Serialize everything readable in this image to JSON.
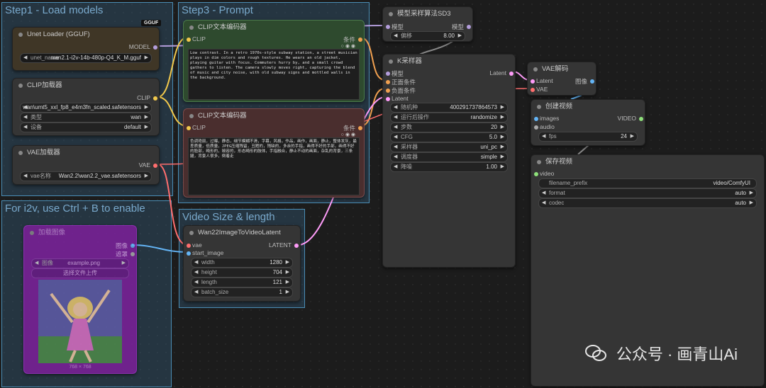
{
  "groups": {
    "step1": "Step1 - Load models",
    "step3": "Step3 - Prompt",
    "i2v": "For i2v, use Ctrl + B to enable",
    "video_size": "Video Size & length"
  },
  "unet_loader": {
    "title": "Unet Loader (GGUF)",
    "badge": "GGUF",
    "output": "MODEL",
    "widget_label": "unet_name",
    "widget_value": "wan2.1-i2v-14b-480p-Q4_K_M.gguf"
  },
  "clip_loader": {
    "title": "CLIP加载器",
    "output": "CLIP",
    "w1_label": "",
    "w1_value": "wan\\umt5_xxl_fp8_e4m3fn_scaled.safetensors",
    "w2_label": "类型",
    "w2_value": "wan",
    "w3_label": "设备",
    "w3_value": "default"
  },
  "vae_loader": {
    "title": "VAE加载器",
    "output": "VAE",
    "widget_label": "vae名称",
    "widget_value": "Wan2.2\\wan2.2_vae.safetensors"
  },
  "load_image": {
    "title": "加载图像",
    "out1": "图像",
    "out2": "遮罩",
    "widget_label": "图像",
    "widget_value": "example.png",
    "upload_label": "选择文件上传",
    "caption": "768 × 768"
  },
  "clip_pos": {
    "title": "CLIP文本编码器",
    "input": "CLIP",
    "output": "条件",
    "text": "Low contrast. In a retro 1970s-style subway station, a street musician plays in dim colors and rough textures. He wears an old jacket, playing guitar with focus. Commuters hurry by, and a small crowd gathers to listen. The camera slowly moves right, capturing the blend of music and city noise, with old subway signs and mottled walls in the background."
  },
  "clip_neg": {
    "title": "CLIP文本编码器",
    "input": "CLIP",
    "output": "条件",
    "text": "色调艳丽，过曝，静态，细节模糊不清，字幕，风格，作品，画作，画面，静止，整体发灰，最差质量，低质量，JPEG压缩残留，丑陋的，残缺的，多余的手指，画得不好的手部，画得不好的脸部，畸形的，毁容的，形态畸形的肢体，手指融合，静止不动的画面，杂乱的背景，三条腿，背景人很多，倒着走"
  },
  "model_sampling": {
    "title": "模型采样算法SD3",
    "input": "模型",
    "output": "模型",
    "widget_label": "偏移",
    "widget_value": "8.00"
  },
  "ksampler": {
    "title": "K采样器",
    "inputs": [
      "模型",
      "正面条件",
      "负面条件",
      "Latent"
    ],
    "output": "Latent",
    "widgets": [
      {
        "label": "随机种",
        "value": "400291737864573"
      },
      {
        "label": "运行后操作",
        "value": "randomize"
      },
      {
        "label": "步数",
        "value": "20"
      },
      {
        "label": "CFG",
        "value": "5.0"
      },
      {
        "label": "采样器",
        "value": "uni_pc"
      },
      {
        "label": "调度器",
        "value": "simple"
      },
      {
        "label": "降噪",
        "value": "1.00"
      }
    ]
  },
  "vae_decode": {
    "title": "VAE解码",
    "in1": "Latent",
    "in2": "VAE",
    "output": "图像"
  },
  "create_video": {
    "title": "创建视频",
    "in1": "images",
    "in2": "audio",
    "output": "VIDEO",
    "widget_label": "fps",
    "widget_value": "24"
  },
  "save_video": {
    "title": "保存视频",
    "input": "video",
    "widgets": [
      {
        "label": "filename_prefix",
        "value": "video/ComfyUI"
      },
      {
        "label": "format",
        "value": "auto"
      },
      {
        "label": "codec",
        "value": "auto"
      }
    ]
  },
  "wan_latent": {
    "title": "Wan22ImageToVideoLatent",
    "in1": "vae",
    "in2": "start_image",
    "output": "LATENT",
    "widgets": [
      {
        "label": "width",
        "value": "1280"
      },
      {
        "label": "height",
        "value": "704"
      },
      {
        "label": "length",
        "value": "121"
      },
      {
        "label": "batch_size",
        "value": "1"
      }
    ]
  },
  "watermark": "公众号 · 画青山Ai",
  "colors": {
    "model": "#b39ddb",
    "clip": "#f2c94c",
    "conditioning": "#f0a050",
    "vae": "#ff6e6e",
    "latent": "#ff9cf9",
    "image": "#64b5f6",
    "video": "#8ee07a"
  }
}
